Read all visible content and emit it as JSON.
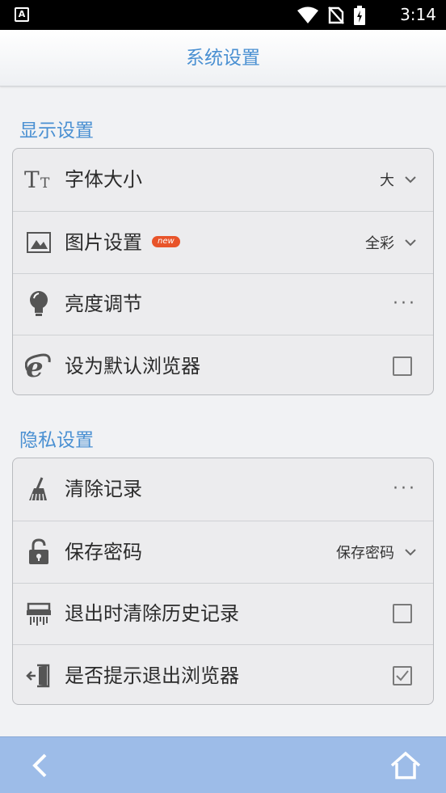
{
  "status": {
    "time": "3:14",
    "left_badge": "A"
  },
  "header": {
    "title": "系统设置"
  },
  "display_section": {
    "title": "显示设置",
    "items": [
      {
        "label": "字体大小",
        "value": "大",
        "icon": "font-size-icon",
        "control": "dropdown"
      },
      {
        "label": "图片设置",
        "badge": "new",
        "value": "全彩",
        "icon": "image-icon",
        "control": "dropdown"
      },
      {
        "label": "亮度调节",
        "icon": "bulb-icon",
        "control": "more",
        "more": "···"
      },
      {
        "label": "设为默认浏览器",
        "icon": "ie-icon",
        "control": "checkbox",
        "checked": false
      }
    ]
  },
  "privacy_section": {
    "title": "隐私设置",
    "items": [
      {
        "label": "清除记录",
        "icon": "broom-icon",
        "control": "more",
        "more": "···"
      },
      {
        "label": "保存密码",
        "value": "保存密码",
        "icon": "lock-icon",
        "control": "dropdown"
      },
      {
        "label": "退出时清除历史记录",
        "icon": "shredder-icon",
        "control": "checkbox",
        "checked": false
      },
      {
        "label": "是否提示退出浏览器",
        "icon": "exit-icon",
        "control": "checkbox",
        "checked": true
      }
    ]
  },
  "colors": {
    "accent": "#4a90d2",
    "bottom_bar": "#9dbce8",
    "badge": "#e8542a"
  }
}
